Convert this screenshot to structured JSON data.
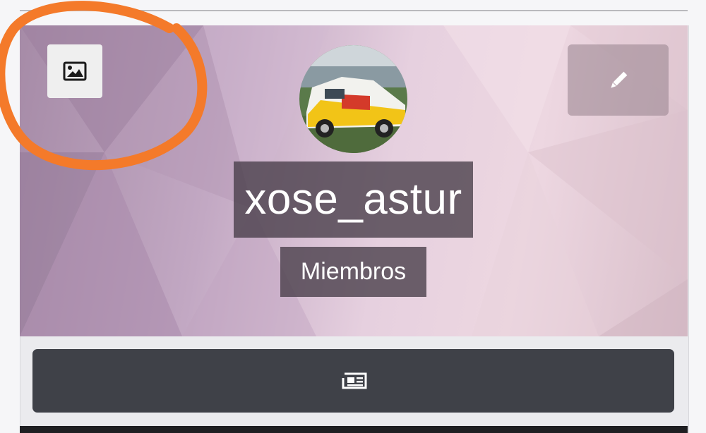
{
  "profile": {
    "username": "xose_astur",
    "role": "Miembros"
  },
  "icons": {
    "cover_photo": "image-icon",
    "edit": "pencil-icon",
    "feed": "newspaper-icon"
  },
  "colors": {
    "annotation": "#f47a2a",
    "bottom_bar": "#3f4148",
    "label_bg": "#463c48"
  }
}
